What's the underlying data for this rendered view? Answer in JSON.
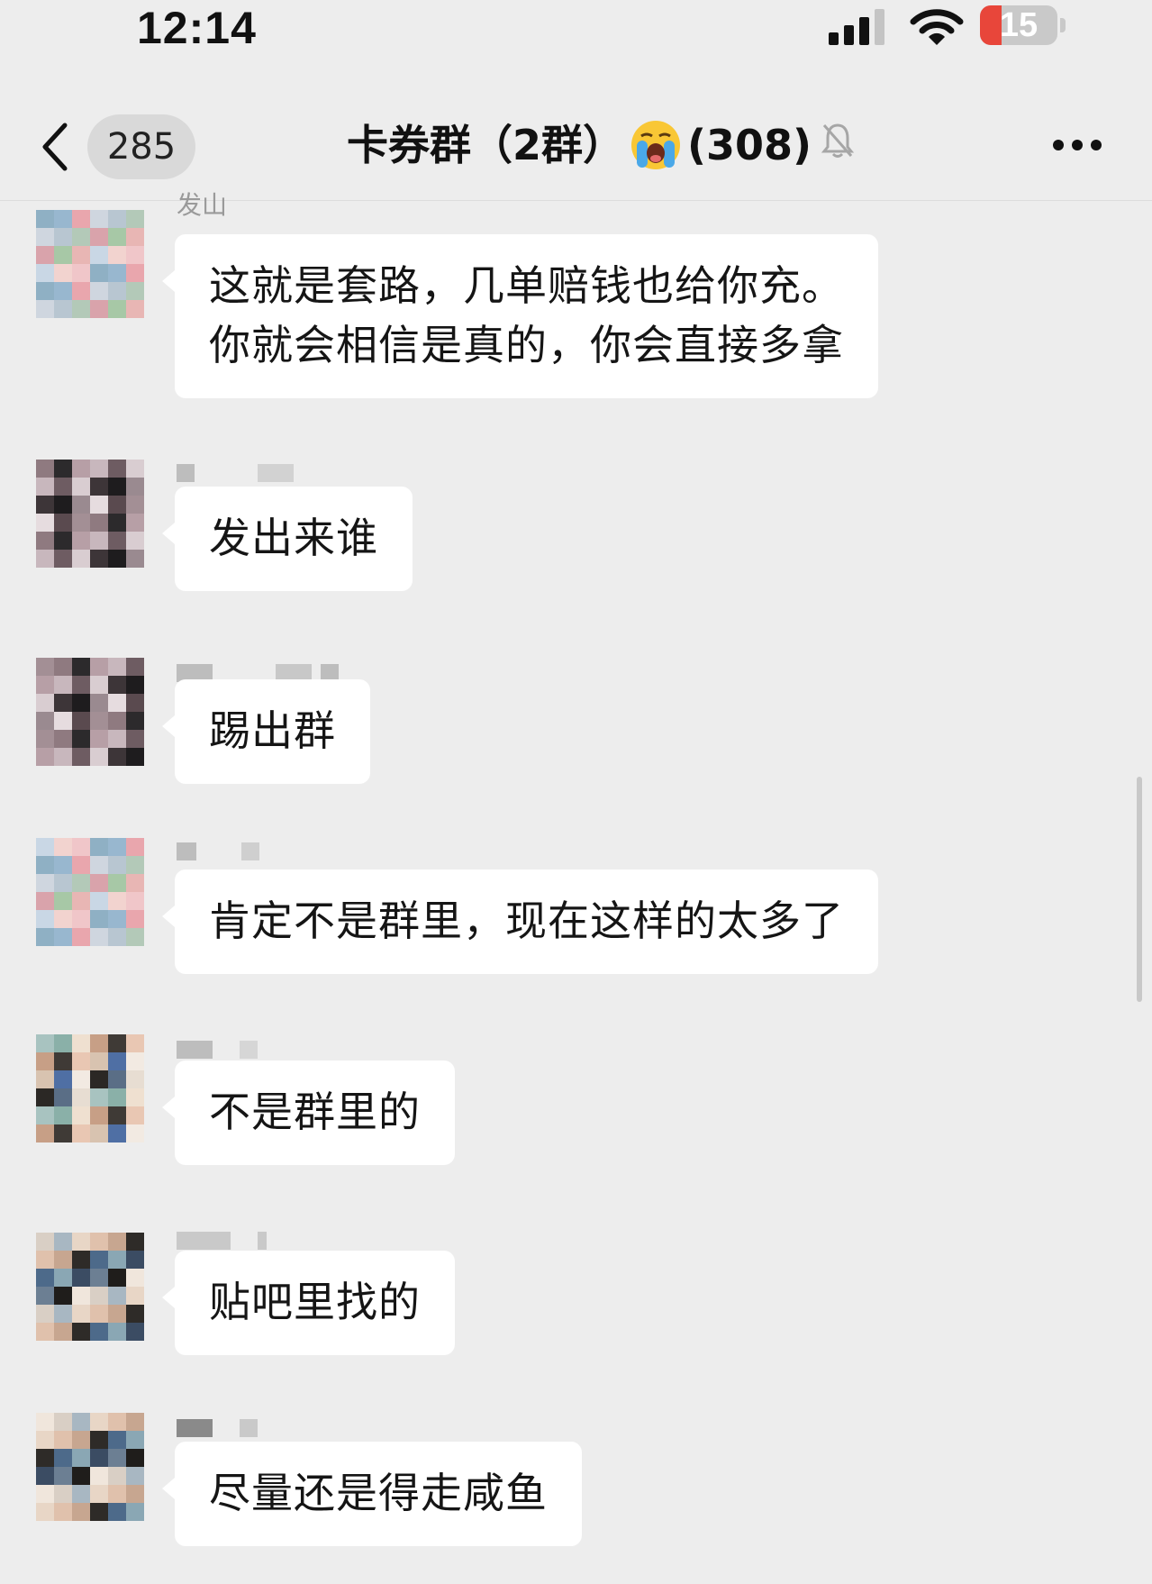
{
  "status_bar": {
    "time": "12:14",
    "battery": "15",
    "battery_level_percent": 15
  },
  "nav": {
    "unread_count": "285",
    "title_prefix": "卡券群（2群）",
    "title_suffix": "(308)",
    "title_emoji": "loudly-crying-face-emoji"
  },
  "messages": [
    {
      "sender": "发山",
      "text_lines": [
        "这就是套路，几单赔钱也给你充。",
        "你就会相信是真的，你会直接多拿"
      ]
    },
    {
      "sender": "",
      "text_lines": [
        "发出来谁"
      ]
    },
    {
      "sender": "",
      "text_lines": [
        "踢出群"
      ]
    },
    {
      "sender": "",
      "text_lines": [
        "肯定不是群里，现在这样的太多了"
      ]
    },
    {
      "sender": "",
      "text_lines": [
        "不是群里的"
      ]
    },
    {
      "sender": "",
      "text_lines": [
        "贴吧里找的"
      ]
    },
    {
      "sender": "",
      "text_lines": [
        "尽量还是得走咸鱼"
      ]
    }
  ],
  "colors": {
    "background": "#ededed",
    "bubble": "#ffffff",
    "battery_low": "#e8463a"
  }
}
